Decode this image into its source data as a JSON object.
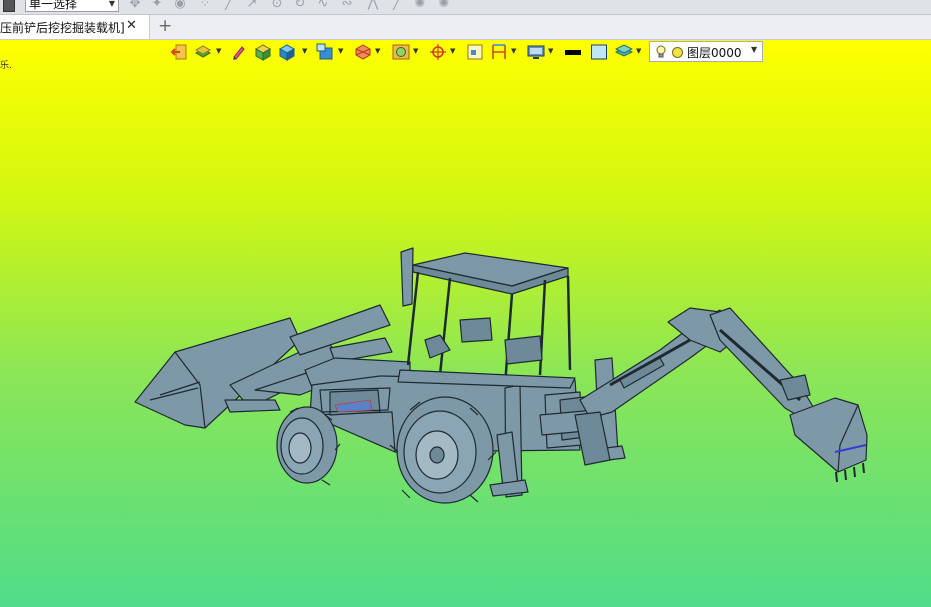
{
  "toolbar": {
    "select_mode": "单一选择"
  },
  "tabs": {
    "document_tab": "压前铲后挖挖掘装载机]",
    "close_glyph": "✕",
    "add_glyph": "+"
  },
  "viewport": {
    "note": "乐.",
    "layer": {
      "name": "图层0000"
    },
    "background_top": "#ffff00",
    "background_bottom": "#50dc8a"
  },
  "model": {
    "color": "#7d99a8",
    "edge_color": "#1e2a30"
  }
}
